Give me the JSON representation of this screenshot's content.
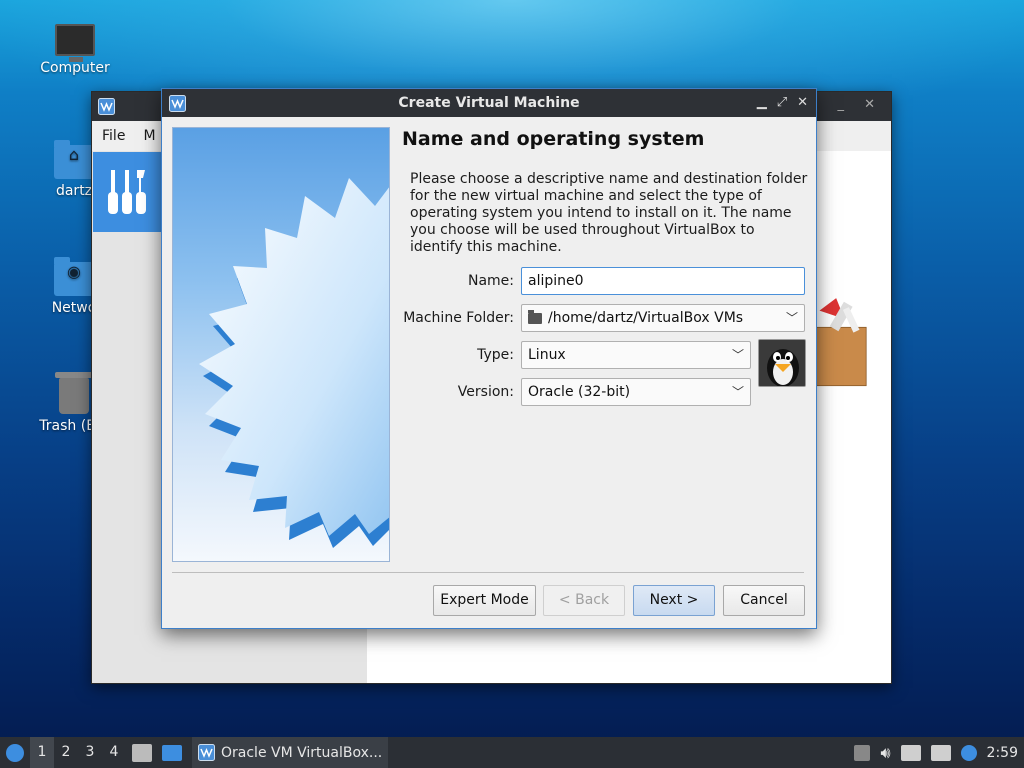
{
  "desktop": {
    "icons": [
      {
        "label": "Computer"
      },
      {
        "label": "dartz"
      },
      {
        "label": "Netwo"
      },
      {
        "label": "Trash (Em"
      }
    ]
  },
  "background_window": {
    "menu": [
      "File",
      "M"
    ]
  },
  "dialog": {
    "title": "Create Virtual Machine",
    "heading": "Name and operating system",
    "description": "Please choose a descriptive name and destination folder for the new virtual machine and select the type of operating system you intend to install on it. The name you choose will be used throughout VirtualBox to identify this machine.",
    "fields": {
      "name_label": "Name:",
      "name_value": "alipine0",
      "folder_label": "Machine Folder:",
      "folder_value": "/home/dartz/VirtualBox VMs",
      "type_label": "Type:",
      "type_value": "Linux",
      "version_label": "Version:",
      "version_value": "Oracle (32-bit)"
    },
    "buttons": {
      "expert": "Expert Mode",
      "back": "< Back",
      "next": "Next >",
      "cancel": "Cancel"
    }
  },
  "taskbar": {
    "workspaces": [
      "1",
      "2",
      "3",
      "4"
    ],
    "active_workspace": "1",
    "app_label": "Oracle VM VirtualBox...",
    "clock": "2:59"
  },
  "colors": {
    "accent": "#3d8ee0",
    "titlebar": "#2e3136"
  }
}
